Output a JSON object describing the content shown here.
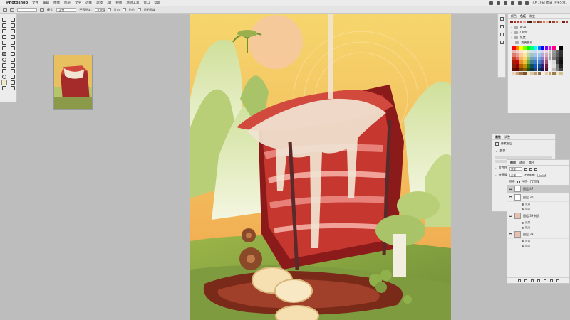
{
  "menubar": {
    "app_name": "Photoshop",
    "items": [
      "文件",
      "编辑",
      "图像",
      "图层",
      "文字",
      "选择",
      "滤镜",
      "3D",
      "视图",
      "增效工具",
      "窗口",
      "帮助"
    ],
    "clock": "4月19日 周日 下午5:01"
  },
  "options": {
    "mode_label": "模式:",
    "mode_value": "正常",
    "opacity_label": "不透明度:",
    "opacity_value": "100%",
    "check1": "反向",
    "check2": "仿色",
    "check3": "透明区域"
  },
  "swatches": {
    "tabs": [
      "颜色",
      "色板",
      "渐变"
    ],
    "groups": [
      "RGB",
      "CMYK",
      "灰度",
      "浅黄色彩"
    ],
    "recent": [
      "#8b1a1a",
      "#a52a2a",
      "#c0392b",
      "#d35454",
      "#e8a0a0",
      "#6b2b1e",
      "#3d1c12",
      "#c97c5d",
      "#7a3a2a",
      "#b5563f",
      "#e07b5f",
      "#f2b6a0",
      "#5a1e14",
      "#9e4030",
      "#cc6a50",
      "#ffd9c9",
      "#701f18",
      "#ad3a2e"
    ],
    "grid_colors": [
      "#ff0000",
      "#ff7f00",
      "#ffff00",
      "#7fff00",
      "#00ff00",
      "#00ff7f",
      "#00ffff",
      "#007fff",
      "#0000ff",
      "#7f00ff",
      "#ff00ff",
      "#ff007f",
      "#ffffff",
      "#000000",
      "#e6b8af",
      "#f4cccc",
      "#fce5cd",
      "#fff2cc",
      "#d9ead3",
      "#d0e0e3",
      "#c9daf8",
      "#cfe2f3",
      "#d9d2e9",
      "#ead1dc",
      "#cccccc",
      "#999999",
      "#666666",
      "#333333",
      "#dd7e6b",
      "#ea9999",
      "#f9cb9c",
      "#ffe599",
      "#b6d7a8",
      "#a2c4c9",
      "#a4c2f4",
      "#9fc5e8",
      "#b4a7d6",
      "#d5a6bd",
      "#b7b7b7",
      "#8e8e8e",
      "#5e5e5e",
      "#2e2e2e",
      "#cc4125",
      "#e06666",
      "#f6b26b",
      "#ffd966",
      "#93c47d",
      "#76a5af",
      "#6d9eeb",
      "#6fa8dc",
      "#8e7cc3",
      "#c27ba0",
      "#a5a5a5",
      "#7a7a7a",
      "#4a4a4a",
      "#1c1c1c",
      "#a61c00",
      "#cc0000",
      "#e69138",
      "#f1c232",
      "#6aa84f",
      "#45818e",
      "#3c78d8",
      "#3d85c6",
      "#674ea7",
      "#a64d79",
      "#efefef",
      "#d9d9d9",
      "#434343",
      "#111111",
      "#85200c",
      "#990000",
      "#b45f06",
      "#bf9000",
      "#38761d",
      "#134f5c",
      "#1155cc",
      "#0b5394",
      "#351c75",
      "#741b47",
      "#f3f3f3",
      "#e0e0e0",
      "#777777",
      "#202020",
      "#5b0f00",
      "#660000",
      "#783f04",
      "#7f6000",
      "#274e13",
      "#0c343d",
      "#1c4587",
      "#073763",
      "#20124d",
      "#4c1130",
      "#fafafa",
      "#c0c0c0",
      "#808080",
      "#404040",
      "#e8d5b7",
      "#c8a27c",
      "#a07850",
      "#7a5230",
      "#f5e6cc",
      "#d9c3a0",
      "#b89b72",
      "#8c6d46",
      "#fbeee0",
      "#e6cfa8",
      "#c4a373",
      "#9c7a4c",
      "#efe3c8",
      "#d4bf95"
    ]
  },
  "properties": {
    "tabs": [
      "属性",
      "调整"
    ],
    "section1": "像素图层",
    "section2": "变换",
    "section3": "对齐并分布",
    "section4": "快速操作"
  },
  "layers": {
    "tabs": [
      "图层",
      "通道",
      "路径"
    ],
    "filter_label": "类型",
    "blend_mode": "正常",
    "opacity_label": "不透明度:",
    "opacity_value": "100%",
    "lock_label": "锁定:",
    "fill_label": "填充:",
    "fill_value": "100%",
    "items": [
      {
        "name": "图层 47",
        "selected": true,
        "has_fx": false
      },
      {
        "name": "图层 30",
        "selected": false,
        "has_fx": true,
        "fx1": "效果",
        "fx2": "描边"
      },
      {
        "name": "图层 39 拷贝",
        "selected": false,
        "has_fx": true,
        "fx1": "效果",
        "fx2": "描边"
      },
      {
        "name": "图层 39",
        "selected": false,
        "has_fx": true,
        "fx1": "效果",
        "fx2": "描边"
      }
    ]
  },
  "colors": {
    "sky_top": "#f7d26b",
    "sky_bottom": "#f0a850",
    "sun": "#f6c8a0",
    "meat_dark": "#8b1a1a",
    "meat_mid": "#c6372f",
    "meat_light": "#e7817a",
    "cream": "#f1e4d2",
    "green_dark": "#6e8e38",
    "green_light": "#c6d88a"
  }
}
